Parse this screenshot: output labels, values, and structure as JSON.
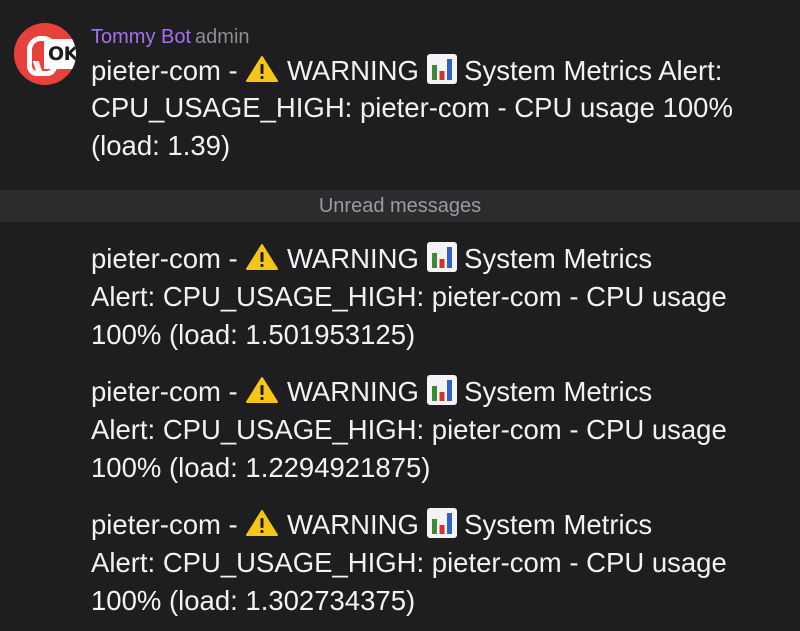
{
  "message_1": {
    "sender": "Tommy Bot",
    "role": "admin",
    "line_1": "pieter-com - ",
    "line_1_b": " WARNING ",
    "line_1_c": " System Metrics Alert:",
    "line_2": "CPU_USAGE_HIGH: pieter-com - CPU usage 100%",
    "line_3": "(load: 1.39)"
  },
  "divider": {
    "label": "Unread messages"
  },
  "message_2": {
    "line_1": "pieter-com - ",
    "line_1_b": " WARNING ",
    "line_1_c": " System Metrics",
    "line_2": "Alert: CPU_USAGE_HIGH: pieter-com - CPU usage",
    "line_3": "100% (load: 1.501953125)"
  },
  "message_3": {
    "line_1": "pieter-com - ",
    "line_1_b": " WARNING ",
    "line_1_c": " System Metrics",
    "line_2": "Alert: CPU_USAGE_HIGH: pieter-com - CPU usage",
    "line_3": "100% (load: 1.2294921875)"
  },
  "message_4": {
    "line_1": "pieter-com - ",
    "line_1_b": " WARNING ",
    "line_1_c": " System Metrics",
    "line_2": "Alert: CPU_USAGE_HIGH: pieter-com - CPU usage",
    "line_3": "100% (load: 1.302734375)"
  },
  "icons": {
    "avatar": "ok-logo-avatar",
    "warning": "warning-icon",
    "chart": "bar-chart-icon"
  },
  "colors": {
    "background": "#1e1e20",
    "sender": "#a571ec",
    "role": "#8d8d92",
    "text": "#f2f2f4",
    "divider_bg": "#2c2c2f",
    "divider_text": "#9b9ba0",
    "avatar_bg": "#e8403a",
    "warning_fill": "#f5c518"
  }
}
